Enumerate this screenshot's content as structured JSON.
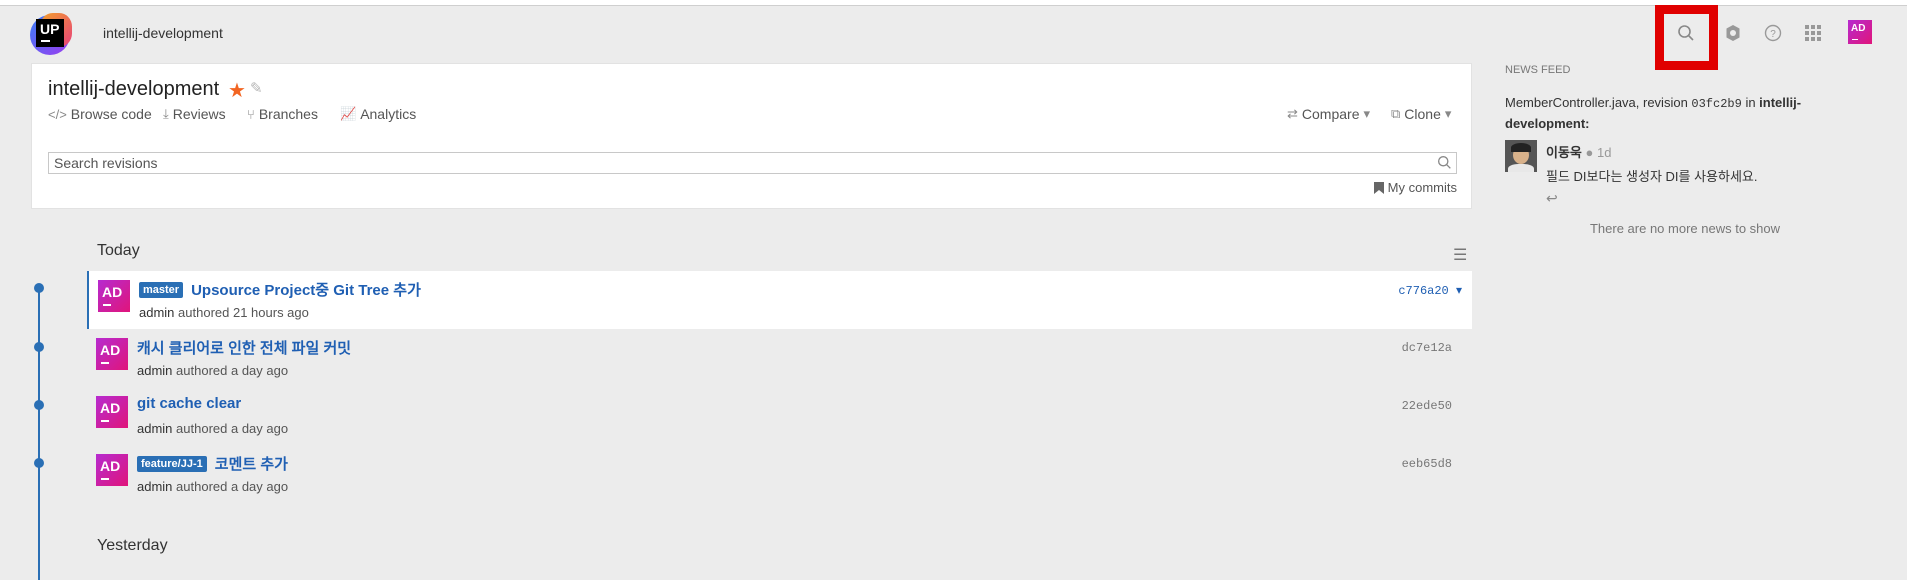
{
  "header": {
    "logo_text": "UP",
    "app_name": "intellij-development",
    "avatar_initials": "AD"
  },
  "project": {
    "title": "intellij-development",
    "nav": {
      "browse_code": "Browse code",
      "reviews": "Reviews",
      "branches": "Branches",
      "analytics": "Analytics",
      "compare": "Compare",
      "clone": "Clone"
    },
    "search": {
      "placeholder": "Search revisions",
      "value": ""
    },
    "my_commits": "My commits"
  },
  "timeline": {
    "today_label": "Today",
    "yesterday_label": "Yesterday",
    "commits": [
      {
        "branch": "master",
        "title": "Upsource Project중 Git Tree 추가",
        "author": "admin",
        "time": "authored 21 hours ago",
        "hash": "c776a20",
        "initials": "AD",
        "selected": true
      },
      {
        "branch": "",
        "title": "캐시 클리어로 인한 전체 파일 커밋",
        "author": "admin",
        "time": "authored a day ago",
        "hash": "dc7e12a",
        "initials": "AD",
        "selected": false
      },
      {
        "branch": "",
        "title": "git cache clear",
        "author": "admin",
        "time": "authored a day ago",
        "hash": "22ede50",
        "initials": "AD",
        "selected": false
      },
      {
        "branch": "feature/JJ-1",
        "title": "코멘트 추가",
        "author": "admin",
        "time": "authored a day ago",
        "hash": "eeb65d8",
        "initials": "AD",
        "selected": false
      }
    ]
  },
  "news_feed": {
    "label": "NEWS FEED",
    "file": "MemberController.java, revision ",
    "revision": "03fc2b9",
    "in_text": " in ",
    "project": "intellij-development:",
    "author": "이동욱",
    "time": "1d",
    "comment": "필드 DI보다는 생성자 DI를 사용하세요.",
    "end_text": "There are no more news to show"
  },
  "colors": {
    "accent": "#2a6fb5",
    "star": "#f26522",
    "highlight": "#e00000"
  }
}
